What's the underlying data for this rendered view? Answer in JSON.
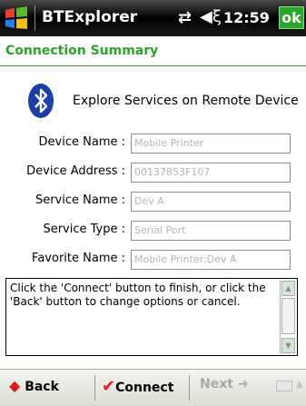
{
  "titlebar": {
    "app_title": "BTExplorer",
    "time": "12:59",
    "ok_label": "ok",
    "connectivity_icon": "connectivity-icon",
    "volume_icon": "speaker-icon",
    "start_icon": "windows-start-icon"
  },
  "header": {
    "title": "Connection Summary"
  },
  "explore": {
    "text": "Explore Services on Remote Device",
    "icon": "bluetooth-icon"
  },
  "form": {
    "fields": [
      {
        "label": "Device Name :",
        "value": "Mobile Printer"
      },
      {
        "label": "Device Address :",
        "value": "00137853F107"
      },
      {
        "label": "Service Name :",
        "value": "Dev A"
      },
      {
        "label": "Service Type :",
        "value": "Serial Port"
      },
      {
        "label": "Favorite Name :",
        "value": "Mobile Printer:Dev A"
      }
    ]
  },
  "instructions": {
    "text": "Click the 'Connect' button to finish, or click the 'Back' button to change options or cancel."
  },
  "toolbar": {
    "back_label": "Back",
    "connect_label": "Connect",
    "next_label": "Next"
  },
  "colors": {
    "accent_green": "#2aa52a",
    "ok_green": "#2aa82a",
    "bluetooth_blue": "#1a3fa8"
  }
}
